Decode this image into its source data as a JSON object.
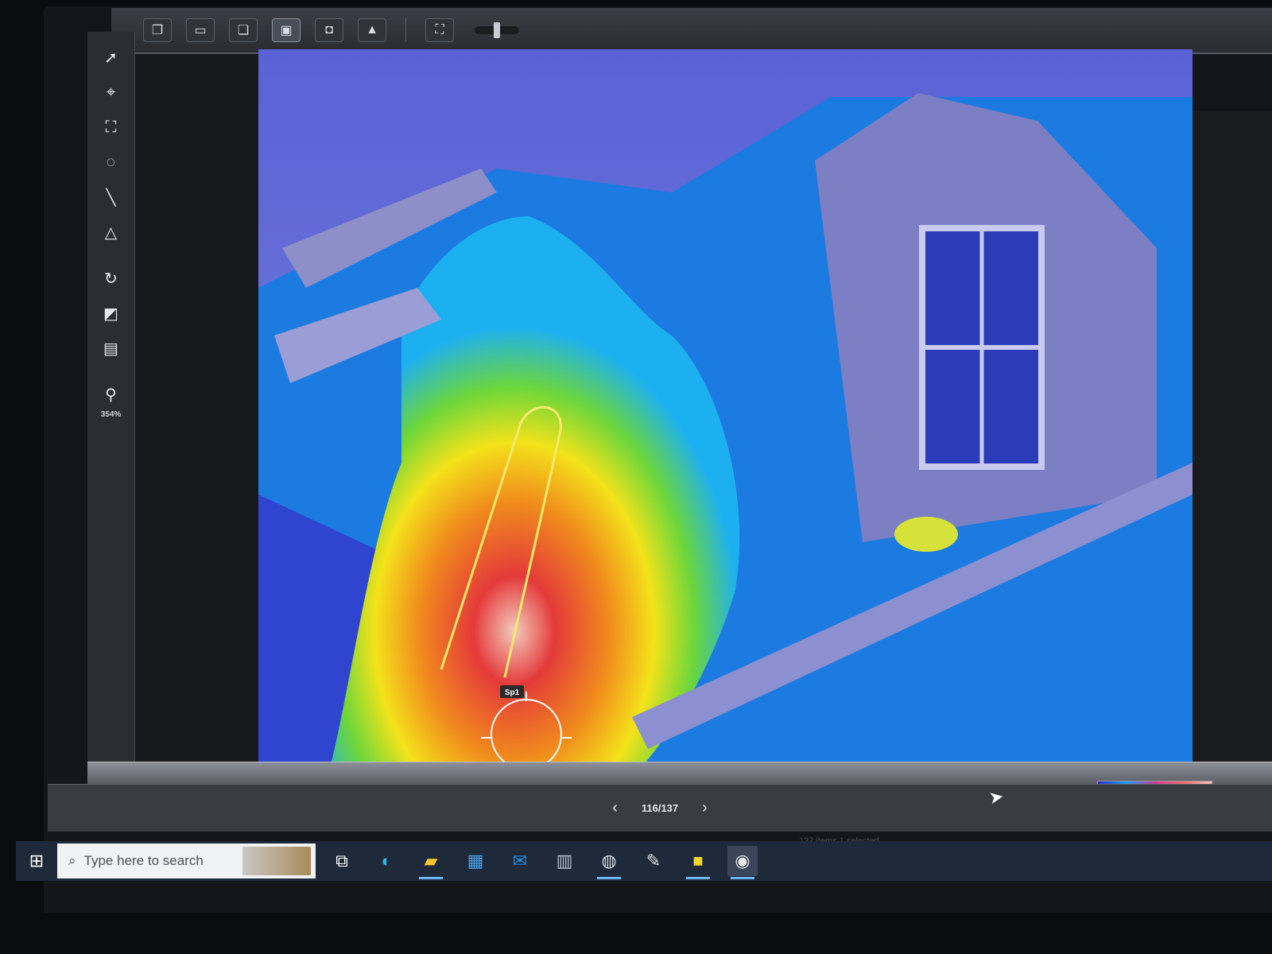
{
  "toolbar": {
    "buttons": [
      {
        "icon": "window-stack-icon"
      },
      {
        "icon": "single-window-icon"
      },
      {
        "icon": "layered-window-icon"
      },
      {
        "icon": "picture-in-picture-icon",
        "active": true
      },
      {
        "icon": "thermal-only-icon"
      },
      {
        "icon": "visual-image-icon"
      },
      {
        "icon": "fit-view-icon"
      }
    ]
  },
  "tools": {
    "items": [
      {
        "icon": "select-arrow-icon"
      },
      {
        "icon": "spot-crosshair-icon"
      },
      {
        "icon": "box-area-icon"
      },
      {
        "icon": "circle-area-icon"
      },
      {
        "icon": "line-tool-icon"
      },
      {
        "icon": "triangle-tool-icon"
      },
      {
        "icon": "rotate-icon"
      },
      {
        "icon": "palette-icon"
      },
      {
        "icon": "color-scale-icon"
      },
      {
        "icon": "zoom-icon"
      }
    ],
    "zoom_label": "354%"
  },
  "measurement": {
    "spot_label": "Sp1"
  },
  "navigation": {
    "prev_icon": "chevron-left-icon",
    "next_icon": "chevron-right-icon",
    "counter": "116/137"
  },
  "status": {
    "text": "137 items  1 selected"
  },
  "taskbar": {
    "search_placeholder": "Type here to search",
    "apps": [
      {
        "icon": "task-view-icon"
      },
      {
        "icon": "edge-icon"
      },
      {
        "icon": "file-explorer-icon"
      },
      {
        "icon": "store-icon"
      },
      {
        "icon": "mail-icon"
      },
      {
        "icon": "calculator-icon"
      },
      {
        "icon": "globe-app-icon"
      },
      {
        "icon": "paint-icon"
      },
      {
        "icon": "sticky-notes-icon"
      },
      {
        "icon": "camera-app-icon"
      }
    ]
  },
  "colors": {
    "thermal_cold": "#2f3fd8",
    "thermal_mid": "#1db0f0",
    "thermal_warm": "#f3e21a",
    "thermal_hot": "#e53030",
    "thermal_hottest": "#f0c8bc"
  }
}
